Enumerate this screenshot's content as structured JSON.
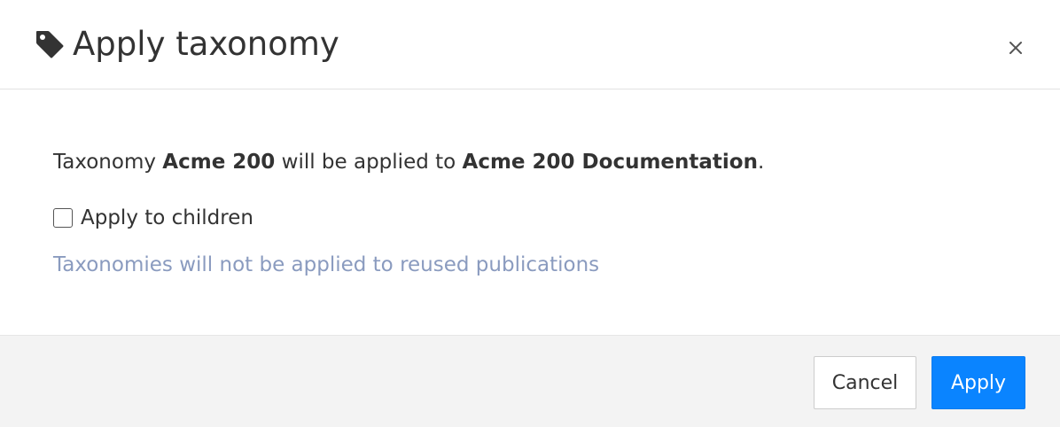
{
  "dialog": {
    "title": "Apply taxonomy",
    "title_icon": "tag-icon",
    "close_icon": "close-icon"
  },
  "message": {
    "prefix": "Taxonomy ",
    "taxonomy_name": "Acme 200",
    "middle": " will be applied to ",
    "publication_name": "Acme 200 Documentation",
    "suffix": "."
  },
  "apply_to_children": {
    "label": "Apply to children",
    "checked": false
  },
  "note": "Taxonomies will not be applied to reused publications",
  "buttons": {
    "cancel": "Cancel",
    "apply": "Apply"
  },
  "colors": {
    "primary": "#0a84ff",
    "note_text": "#8a9bbf",
    "footer_bg": "#f3f3f3"
  }
}
